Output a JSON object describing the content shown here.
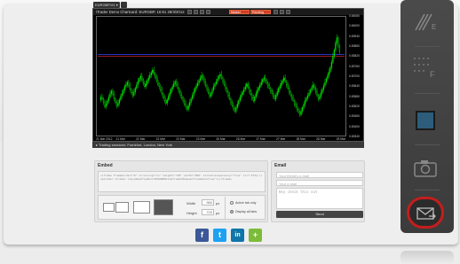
{
  "symbol_select": "EURGBP,H1",
  "chart": {
    "title": "iTrader Demo Chartcard: EURGBP, 16:51 28/3/2012",
    "toolbar_labels": [
      "Market",
      "Pending"
    ],
    "y_ticks": [
      "0.84060",
      "0.84000",
      "0.83940",
      "0.83880",
      "0.83820",
      "0.83760",
      "0.83700",
      "0.83640",
      "0.83580",
      "0.83520",
      "0.83460",
      "0.83400",
      "0.83340"
    ],
    "x_ticks": [
      "21 Mar 2012",
      "21 Mar",
      "22 Mar",
      "22 Mar",
      "23 Mar",
      "23 Mar",
      "26 Mar",
      "26 Mar",
      "27 Mar",
      "27 Mar",
      "28 Mar",
      "28 Mar",
      "29 Mar"
    ],
    "colors": {
      "background": "#000000",
      "candle": "#00e000",
      "bid_line": "#cc2222",
      "ask_line": "#3344ff"
    }
  },
  "sessions": "▸ Trading sessions: Frankfurt, London, New York",
  "embed": {
    "title": "Embed",
    "code": "<iframe frameborder=\"0\" scrolling=\"no\" height=\"720\" width=\"960\" allowtransparency=\"true\" src=\"http://uptrader.itrader.com/embed?symbol=EURGBP&timeframe=H1&ask=true&bid=true\"></iframe>",
    "width_label": "Width",
    "width_value": "960",
    "height_label": "Height",
    "height_value": "720",
    "unit": "px",
    "radio_active": "Active tab only",
    "radio_all": "Display all tabs"
  },
  "email": {
    "title": "Email",
    "friend_placeholder": "Your friend's e-mail",
    "your_placeholder": "Your e-mail",
    "message_placeholder": "Hey check this out",
    "send_label": "Send"
  },
  "social": [
    {
      "name": "facebook",
      "glyph": "f",
      "color": "#3b5998"
    },
    {
      "name": "twitter",
      "glyph": "t",
      "color": "#1da1f2"
    },
    {
      "name": "linkedin",
      "glyph": "in",
      "color": "#0e76a8"
    },
    {
      "name": "more",
      "glyph": "+",
      "color": "#7cbc3a"
    }
  ],
  "sidebar_icons": [
    "chart-type-icon",
    "indicators-icon",
    "color-icon",
    "screenshot-icon",
    "share-icon"
  ]
}
